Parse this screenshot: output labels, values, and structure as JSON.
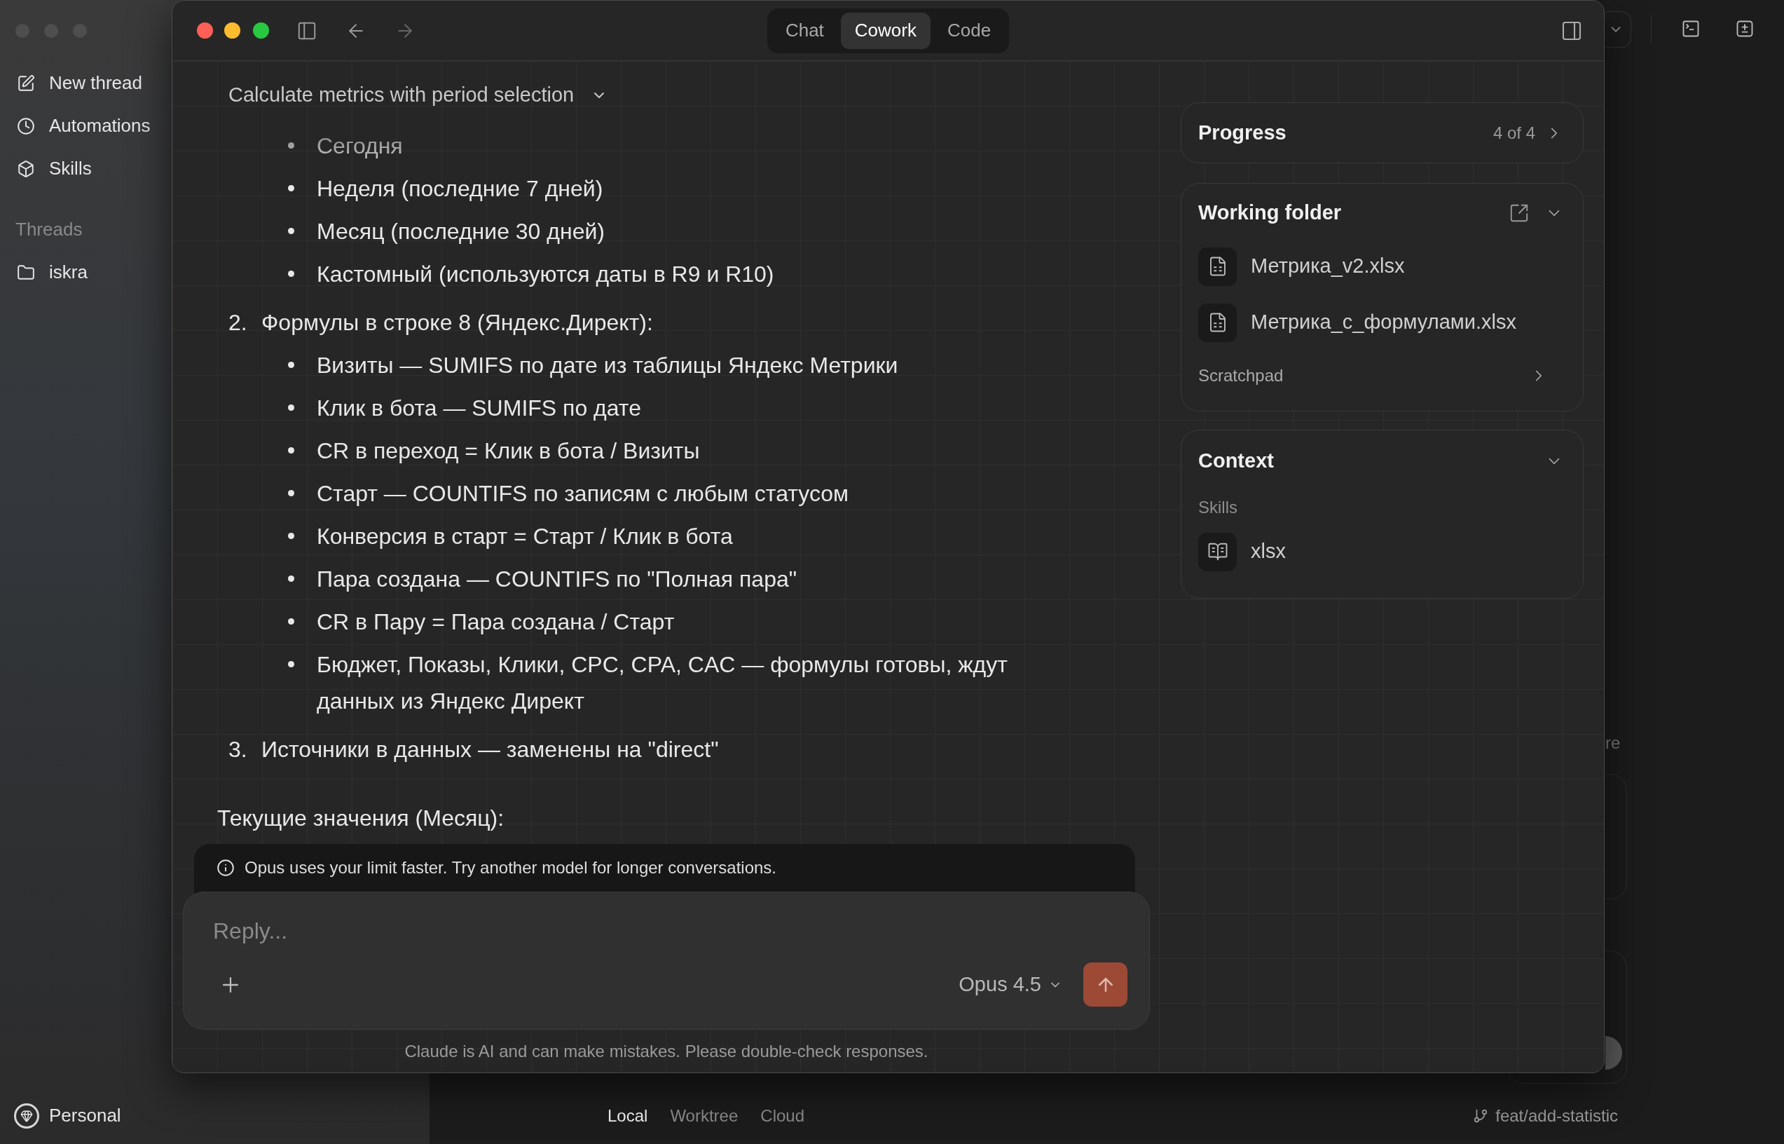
{
  "background_app": {
    "sidebar": {
      "items": [
        {
          "label": "New thread"
        },
        {
          "label": "Automations"
        },
        {
          "label": "Skills"
        }
      ],
      "threads_heading": "Threads",
      "threads": [
        {
          "label": "iskra"
        }
      ],
      "account": "Personal"
    },
    "partial_text": "re",
    "bottom_bar": {
      "tabs": [
        {
          "label": "Local",
          "selected": true
        },
        {
          "label": "Worktree",
          "selected": false
        },
        {
          "label": "Cloud",
          "selected": false
        }
      ],
      "branch": "feat/add-statistic"
    }
  },
  "window": {
    "tabs": [
      {
        "label": "Chat",
        "selected": false
      },
      {
        "label": "Cowork",
        "selected": true
      },
      {
        "label": "Code",
        "selected": false
      }
    ],
    "conversation": {
      "title": "Calculate metrics with period selection",
      "list": [
        {
          "children": [
            {
              "text": "Сегодня"
            },
            {
              "text": "Неделя (последние 7 дней)"
            },
            {
              "text": "Месяц (последние 30 дней)"
            },
            {
              "text": "Кастомный (используются даты в R9 и R10)"
            }
          ]
        },
        {
          "number": "2.",
          "text": "Формулы в строке 8 (Яндекс.Директ):",
          "children": [
            {
              "text": "Визиты — SUMIFS по дате из таблицы Яндекс Метрики"
            },
            {
              "text": "Клик в бота — SUMIFS по дате"
            },
            {
              "text": "CR в переход = Клик в бота / Визиты"
            },
            {
              "text": "Старт — COUNTIFS по записям с любым статусом"
            },
            {
              "text": "Конверсия в старт = Старт / Клик в бота"
            },
            {
              "text": "Пара создана — COUNTIFS по \"Полная пара\""
            },
            {
              "text": "CR в Пару = Пара создана / Старт"
            },
            {
              "text": "Бюджет, Показы, Клики, CPC, CPA, CAC — формулы готовы, ждут данных из Яндекс Директ"
            }
          ]
        },
        {
          "number": "3.",
          "text": "Источники в данных — заменены на \"direct\""
        }
      ],
      "heading": "Текущие значения (Месяц):"
    },
    "notice": "Opus uses your limit faster. Try another model for longer conversations.",
    "composer": {
      "placeholder": "Reply...",
      "model": "Opus 4.5"
    },
    "disclaimer": "Claude is AI and can make mistakes. Please double-check responses."
  },
  "side_panel": {
    "progress": {
      "title": "Progress",
      "count": "4 of 4"
    },
    "working_folder": {
      "title": "Working folder",
      "files": [
        {
          "name": "Метрика_v2.xlsx"
        },
        {
          "name": "Метрика_с_формулами.xlsx"
        }
      ],
      "scratchpad": "Scratchpad"
    },
    "context": {
      "title": "Context",
      "section": "Skills",
      "skills": [
        {
          "name": "xlsx"
        }
      ]
    }
  }
}
